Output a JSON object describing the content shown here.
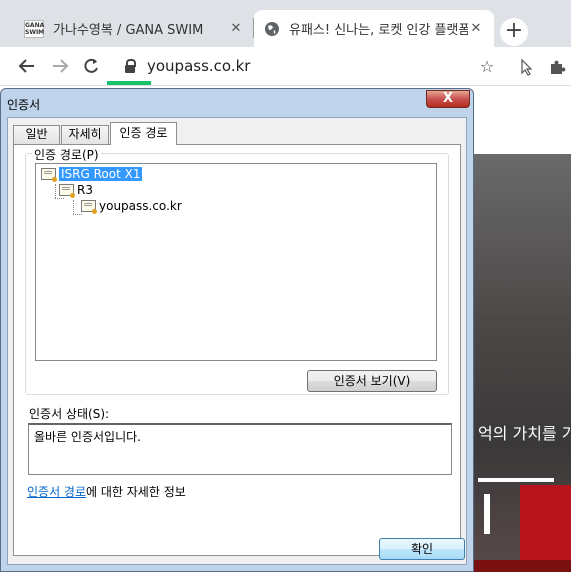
{
  "browser": {
    "tabs": [
      {
        "favicon_text": [
          "GANA",
          "SWIM"
        ],
        "title": "가나수영복 / GANA SWIM",
        "close": "✕"
      },
      {
        "title": "유패스! 신나는, 로켓 인강 플랫폼",
        "close": "✕"
      }
    ],
    "new_tab": "+",
    "url": "youpass.co.kr"
  },
  "page": {
    "hero_text": "억의 가치를 가"
  },
  "dialog": {
    "title": "인증서",
    "close": "X",
    "tabs": [
      "일반",
      "자세히",
      "인증 경로"
    ],
    "group_label": "인증 경로(P)",
    "tree": [
      "ISRG Root X1",
      "R3",
      "youpass.co.kr"
    ],
    "view_button": "인증서 보기(V)",
    "status_label": "인증서 상태(S):",
    "status_text": "올바른 인증서입니다.",
    "more_info_link": "인증서 경로",
    "more_info_rest": "에 대한 자세한 정보",
    "ok_button": "확인"
  }
}
